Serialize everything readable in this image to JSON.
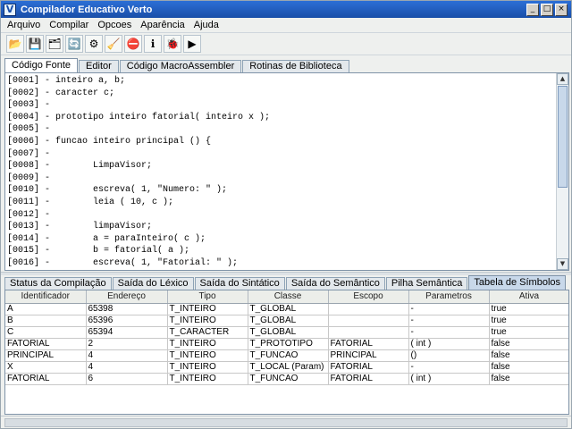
{
  "window": {
    "title": "Compilador Educativo Verto",
    "icon_letter": "V",
    "controls": [
      "_",
      "□",
      "×"
    ]
  },
  "menu": [
    "Arquivo",
    "Compilar",
    "Opcoes",
    "Aparência",
    "Ajuda"
  ],
  "toolbar": [
    {
      "name": "open-folder-icon",
      "glyph": "📂"
    },
    {
      "name": "save-icon",
      "glyph": "💾"
    },
    {
      "name": "save-all-icon",
      "glyph": "🗂"
    },
    {
      "name": "refresh-icon",
      "glyph": "🔄"
    },
    {
      "name": "compile-icon",
      "glyph": "⚙"
    },
    {
      "name": "clear-icon",
      "glyph": "🧹"
    },
    {
      "name": "stop-icon",
      "glyph": "⛔"
    },
    {
      "name": "info-icon",
      "glyph": "ℹ"
    },
    {
      "name": "bug-icon",
      "glyph": "🐞"
    },
    {
      "name": "run-icon",
      "glyph": "▶"
    }
  ],
  "top_tabs": [
    "Código Fonte",
    "Editor",
    "Código MacroAssembler",
    "Rotinas de Biblioteca"
  ],
  "top_tab_active": 0,
  "code_lines": [
    "[0001] - inteiro a, b;",
    "[0002] - caracter c;",
    "[0003] -",
    "[0004] - prototipo inteiro fatorial( inteiro x );",
    "[0005] -",
    "[0006] - funcao inteiro principal () {",
    "[0007] -",
    "[0008] -        LimpaVisor;",
    "[0009] -",
    "[0010] -        escreva( 1, \"Numero: \" );",
    "[0011] -        leia ( 10, c );",
    "[0012] -",
    "[0013] -        limpaVisor;",
    "[0014] -        a = paraInteiro( c );",
    "[0015] -        b = fatorial( a );",
    "[0016] -        escreva( 1, \"Fatorial: \" );"
  ],
  "bottom_tabs": [
    "Status da Compilação",
    "Saída do Léxico",
    "Saída do Sintático",
    "Saída do Semântico",
    "Pilha Semântica",
    "Tabela de Símbolos"
  ],
  "bottom_tab_active": 5,
  "symbol_table": {
    "columns": [
      "Identificador",
      "Endereço",
      "Tipo",
      "Classe",
      "Escopo",
      "Parametros",
      "Ativa"
    ],
    "rows": [
      [
        "A",
        "65398",
        "T_INTEIRO",
        "T_GLOBAL",
        "",
        "-",
        "true"
      ],
      [
        "B",
        "65396",
        "T_INTEIRO",
        "T_GLOBAL",
        "",
        "-",
        "true"
      ],
      [
        "C",
        "65394",
        "T_CARACTER",
        "T_GLOBAL",
        "",
        "-",
        "true"
      ],
      [
        "FATORIAL",
        "2",
        "T_INTEIRO",
        "T_PROTOTIPO",
        "FATORIAL",
        "( int )",
        "false"
      ],
      [
        "PRINCIPAL",
        "4",
        "T_INTEIRO",
        "T_FUNCAO",
        "PRINCIPAL",
        "()",
        "false"
      ],
      [
        "X",
        "4",
        "T_INTEIRO",
        "T_LOCAL (Param)",
        "FATORIAL",
        "-",
        "false"
      ],
      [
        "FATORIAL",
        "6",
        "T_INTEIRO",
        "T_FUNCAO",
        "FATORIAL",
        "( int )",
        "false"
      ]
    ]
  }
}
